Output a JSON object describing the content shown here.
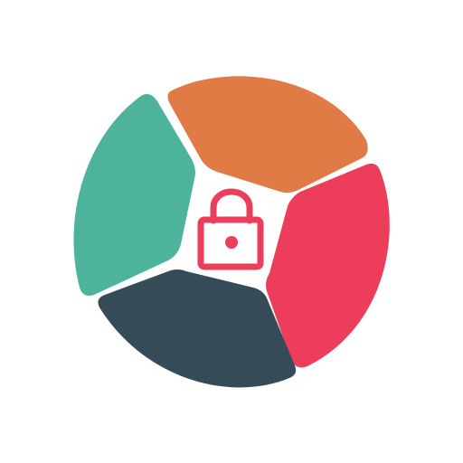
{
  "app_icon": {
    "name": "segmented-wheel-lock",
    "palette": {
      "top": "#E07B45",
      "right": "#EC3D5A",
      "bottom": "#354B58",
      "left": "#4DB39B",
      "lock": "#EC3D5A",
      "background": "#FFFFFF"
    },
    "center_icon": "padlock-icon"
  }
}
